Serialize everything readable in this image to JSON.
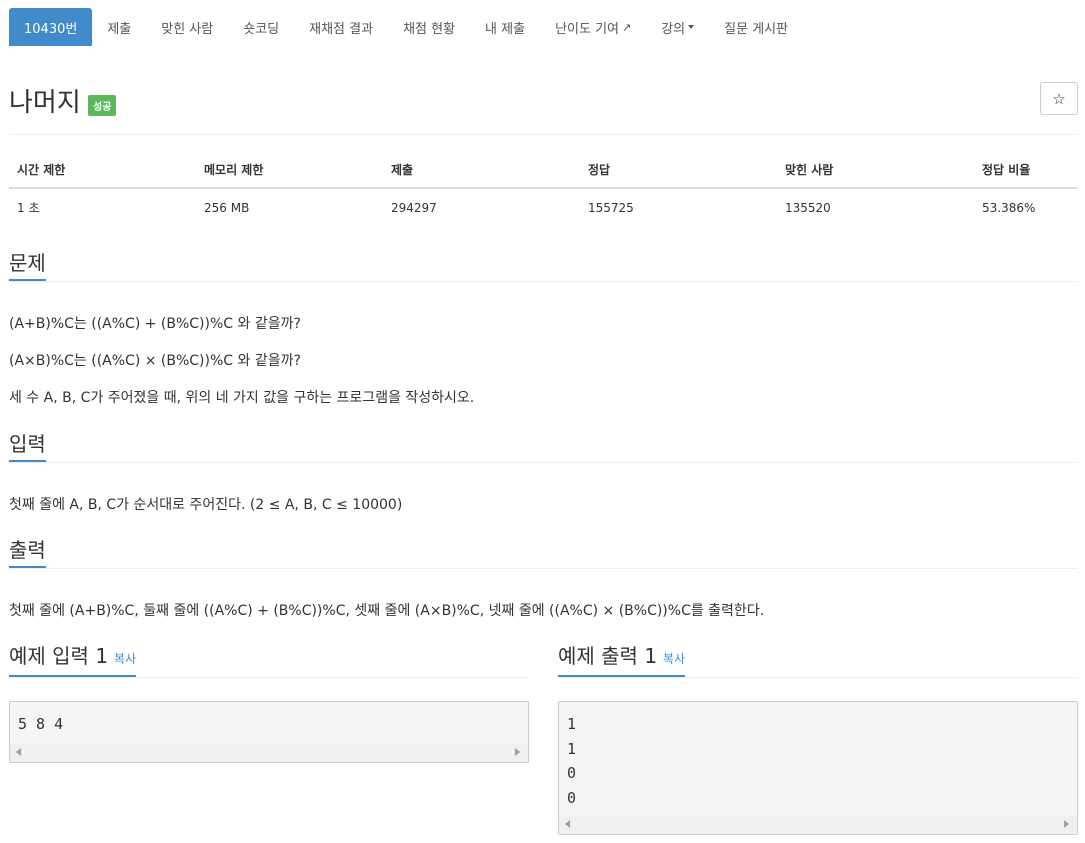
{
  "nav": {
    "tabs": [
      {
        "label": "10430번"
      },
      {
        "label": "제출"
      },
      {
        "label": "맞힌 사람"
      },
      {
        "label": "숏코딩"
      },
      {
        "label": "재채점 결과"
      },
      {
        "label": "채점 현황"
      },
      {
        "label": "내 제출"
      },
      {
        "label": "난이도 기여"
      },
      {
        "label": "강의"
      },
      {
        "label": "질문 게시판"
      }
    ]
  },
  "problem": {
    "title": "나머지",
    "badge": "성공",
    "star_glyph": "☆"
  },
  "info": {
    "headers": [
      "시간 제한",
      "메모리 제한",
      "제출",
      "정답",
      "맞힌 사람",
      "정답 비율"
    ],
    "values": [
      "1 초",
      "256 MB",
      "294297",
      "155725",
      "135520",
      "53.386%"
    ]
  },
  "sections": {
    "description": {
      "heading": "문제",
      "lines": [
        "(A+B)%C는 ((A%C) + (B%C))%C 와 같을까?",
        "(A×B)%C는 ((A%C) × (B%C))%C 와 같을까?",
        "세 수 A, B, C가 주어졌을 때, 위의 네 가지 값을 구하는 프로그램을 작성하시오."
      ]
    },
    "input": {
      "heading": "입력",
      "text": "첫째 줄에 A, B, C가 순서대로 주어진다. (2 ≤ A, B, C ≤ 10000)"
    },
    "output": {
      "heading": "출력",
      "text": "첫째 줄에 (A+B)%C, 둘째 줄에 ((A%C) + (B%C))%C, 셋째 줄에 (A×B)%C, 넷째 줄에 ((A%C) × (B%C))%C를 출력한다."
    }
  },
  "samples": {
    "input": {
      "heading": "예제 입력 1",
      "copy": "복사",
      "lines": [
        "5 8 4"
      ]
    },
    "output": {
      "heading": "예제 출력 1",
      "copy": "복사",
      "lines": [
        "1",
        "1",
        "0",
        "0"
      ]
    }
  }
}
